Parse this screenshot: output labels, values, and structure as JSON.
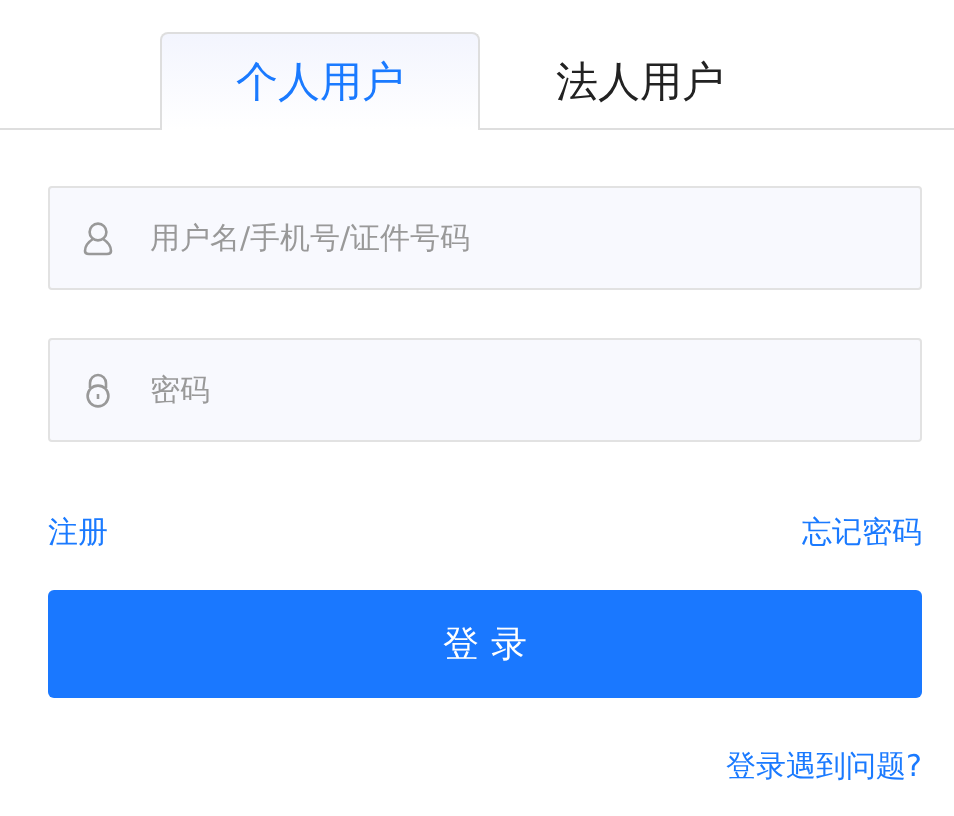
{
  "tabs": [
    {
      "label": "个人用户",
      "selected": true
    },
    {
      "label": "法人用户",
      "selected": false
    }
  ],
  "fields": [
    {
      "kind": "user",
      "placeholder": "用户名/手机号/证件号码"
    },
    {
      "kind": "password",
      "placeholder": "密码"
    }
  ],
  "links": {
    "register": "注册",
    "forgot": "忘记密码"
  },
  "login_button": "登 录",
  "help_link": "登录遇到问题?"
}
